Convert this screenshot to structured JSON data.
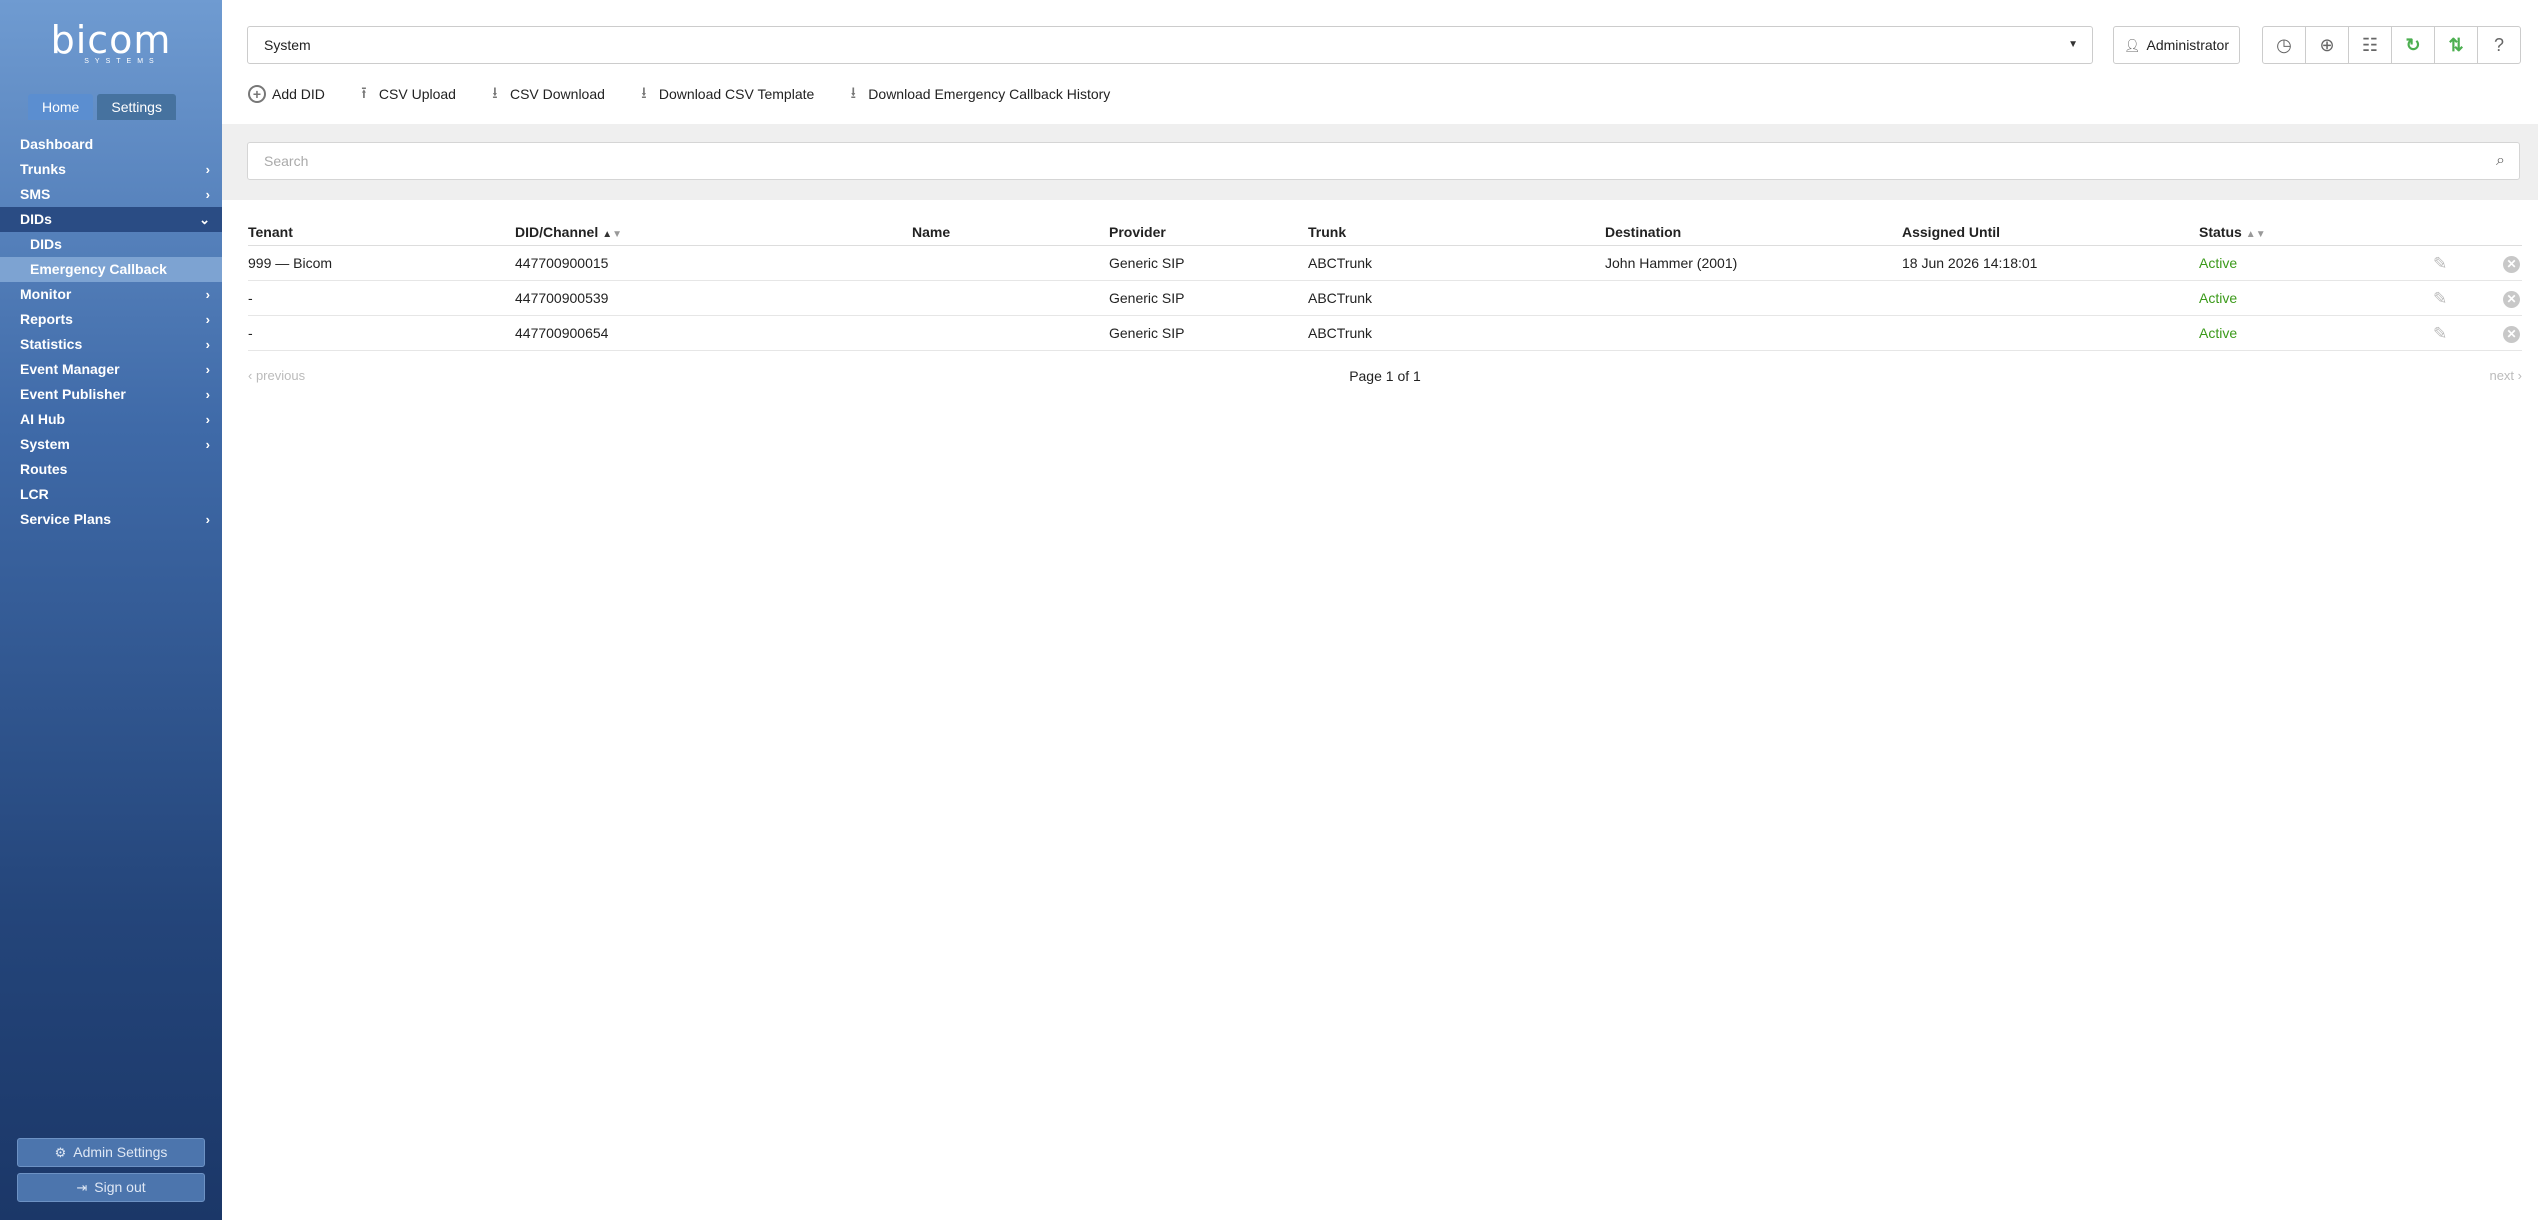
{
  "brand": {
    "logo_text": "bicom",
    "logo_sub": "SYSTEMS"
  },
  "sidebar": {
    "tabs": [
      {
        "label": "Home",
        "active": true
      },
      {
        "label": "Settings",
        "active": false
      }
    ],
    "menu": [
      {
        "label": "Dashboard"
      },
      {
        "label": "Trunks"
      },
      {
        "label": "SMS"
      },
      {
        "label": "DIDs"
      },
      {
        "label": "DIDs"
      },
      {
        "label": "Emergency Callback"
      },
      {
        "label": "Monitor"
      },
      {
        "label": "Reports"
      },
      {
        "label": "Statistics"
      },
      {
        "label": "Event Manager"
      },
      {
        "label": "Event Publisher"
      },
      {
        "label": "AI Hub"
      },
      {
        "label": "System"
      },
      {
        "label": "Routes"
      },
      {
        "label": "LCR"
      },
      {
        "label": "Service Plans"
      }
    ],
    "admin_settings_label": "Admin Settings",
    "sign_out_label": "Sign out"
  },
  "header": {
    "tenant_select_value": "System",
    "user_label": "Administrator",
    "tools": [
      "clock-icon",
      "globe-icon",
      "network-icon",
      "refresh-icon",
      "sync-icon",
      "help-icon"
    ]
  },
  "toolbar": {
    "add_did": "Add DID",
    "csv_upload": "CSV Upload",
    "csv_download": "CSV Download",
    "download_template": "Download CSV Template",
    "download_history": "Download Emergency Callback History"
  },
  "search": {
    "placeholder": "Search"
  },
  "table": {
    "columns": {
      "tenant": "Tenant",
      "did": "DID/Channel",
      "name": "Name",
      "provider": "Provider",
      "trunk": "Trunk",
      "destination": "Destination",
      "assigned_until": "Assigned Until",
      "status": "Status"
    },
    "rows": [
      {
        "tenant": "999  —  Bicom",
        "did": "447700900015",
        "name": "",
        "provider": "Generic SIP",
        "trunk": "ABCTrunk",
        "destination": "John Hammer (2001)",
        "assigned_until": "18 Jun 2026 14:18:01",
        "status": "Active"
      },
      {
        "tenant": "-",
        "did": "447700900539",
        "name": "",
        "provider": "Generic SIP",
        "trunk": "ABCTrunk",
        "destination": "",
        "assigned_until": "",
        "status": "Active"
      },
      {
        "tenant": "-",
        "did": "447700900654",
        "name": "",
        "provider": "Generic SIP",
        "trunk": "ABCTrunk",
        "destination": "",
        "assigned_until": "",
        "status": "Active"
      }
    ]
  },
  "pager": {
    "previous": "previous",
    "page_text": "Page 1 of 1",
    "next": "next"
  },
  "colors": {
    "status_active": "#3b9a1a",
    "sidebar_top": "#6f9bd1",
    "sidebar_bottom": "#1b3768",
    "refresh_green": "#4caf50"
  }
}
